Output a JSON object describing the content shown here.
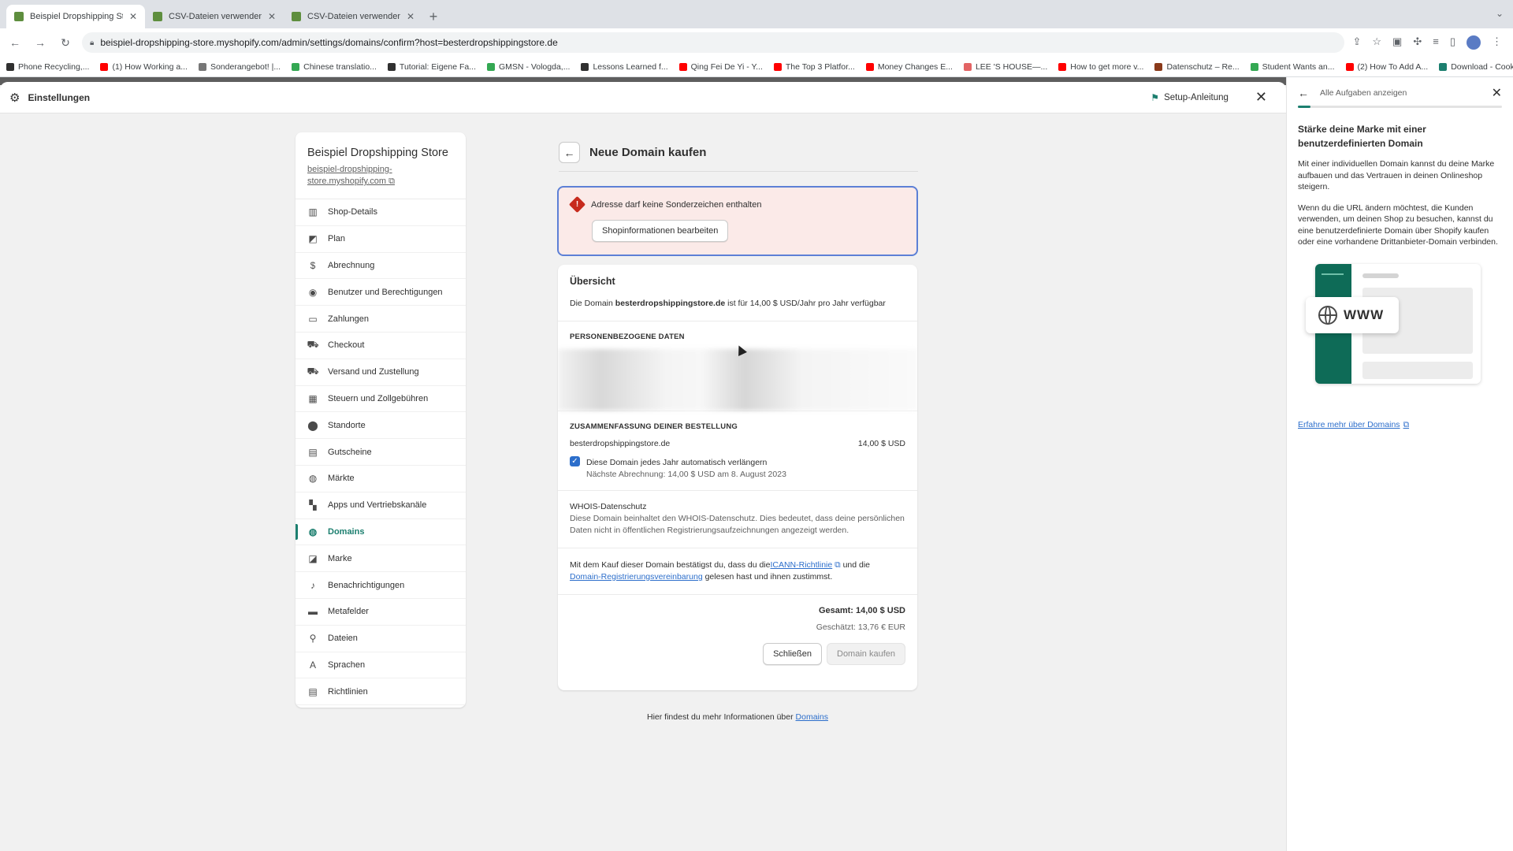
{
  "browser": {
    "tabs": [
      {
        "title": "Beispiel Dropshipping Store · S",
        "active": true
      },
      {
        "title": "CSV-Dateien verwenden, um P",
        "active": false
      },
      {
        "title": "CSV-Dateien verwenden, um P",
        "active": false
      }
    ],
    "new_tab": "+",
    "url": "beispiel-dropshipping-store.myshopify.com/admin/settings/domains/confirm?host=besterdropshippingstore.de",
    "bookmarks": [
      {
        "label": "Phone Recycling,...",
        "color": "#303030"
      },
      {
        "label": "(1) How Working a...",
        "color": "#ff0000"
      },
      {
        "label": "Sonderangebot! |...",
        "color": "#777777"
      },
      {
        "label": "Chinese translatio...",
        "color": "#34a853"
      },
      {
        "label": "Tutorial: Eigene Fa...",
        "color": "#303030"
      },
      {
        "label": "GMSN - Vologda,...",
        "color": "#34a853"
      },
      {
        "label": "Lessons Learned f...",
        "color": "#303030"
      },
      {
        "label": "Qing Fei De Yi - Y...",
        "color": "#ff0000"
      },
      {
        "label": "The Top 3 Platfor...",
        "color": "#ff0000"
      },
      {
        "label": "Money Changes E...",
        "color": "#ff0000"
      },
      {
        "label": "LEE 'S HOUSE—...",
        "color": "#e36464"
      },
      {
        "label": "How to get more v...",
        "color": "#ff0000"
      },
      {
        "label": "Datenschutz – Re...",
        "color": "#8a3a1a"
      },
      {
        "label": "Student Wants an...",
        "color": "#34a853"
      },
      {
        "label": "(2) How To Add A...",
        "color": "#ff0000"
      },
      {
        "label": "Download - Cooki...",
        "color": "#1c7f6f"
      }
    ]
  },
  "settings": {
    "title": "Einstellungen",
    "setup_label": "Setup-Anleitung"
  },
  "store": {
    "name": "Beispiel Dropshipping Store",
    "url": "beispiel-dropshipping-store.myshopify.com"
  },
  "nav": [
    {
      "label": "Shop-Details",
      "icon": "store-icon",
      "glyph": "▥"
    },
    {
      "label": "Plan",
      "icon": "plan-icon",
      "glyph": "◩"
    },
    {
      "label": "Abrechnung",
      "icon": "billing-icon",
      "glyph": "$"
    },
    {
      "label": "Benutzer und Berechtigungen",
      "icon": "user-icon",
      "glyph": "◉"
    },
    {
      "label": "Zahlungen",
      "icon": "payments-icon",
      "glyph": "▭"
    },
    {
      "label": "Checkout",
      "icon": "cart-icon",
      "glyph": "⛟"
    },
    {
      "label": "Versand und Zustellung",
      "icon": "truck-icon",
      "glyph": "⛟"
    },
    {
      "label": "Steuern und Zollgebühren",
      "icon": "tax-icon",
      "glyph": "▦"
    },
    {
      "label": "Standorte",
      "icon": "location-icon",
      "glyph": "⬤"
    },
    {
      "label": "Gutscheine",
      "icon": "gift-icon",
      "glyph": "▤"
    },
    {
      "label": "Märkte",
      "icon": "globe-icon",
      "glyph": "◍"
    },
    {
      "label": "Apps und Vertriebskanäle",
      "icon": "apps-icon",
      "glyph": "▚"
    },
    {
      "label": "Domains",
      "icon": "domains-icon",
      "glyph": "◍",
      "active": true
    },
    {
      "label": "Marke",
      "icon": "brand-icon",
      "glyph": "◪"
    },
    {
      "label": "Benachrichtigungen",
      "icon": "bell-icon",
      "glyph": "♪"
    },
    {
      "label": "Metafelder",
      "icon": "metafields-icon",
      "glyph": "▬"
    },
    {
      "label": "Dateien",
      "icon": "paperclip-icon",
      "glyph": "⚲"
    },
    {
      "label": "Sprachen",
      "icon": "language-icon",
      "glyph": "A"
    },
    {
      "label": "Richtlinien",
      "icon": "policy-icon",
      "glyph": "▤"
    }
  ],
  "page": {
    "title": "Neue Domain kaufen",
    "alert": {
      "message": "Adresse darf keine Sonderzeichen enthalten",
      "button": "Shopinformationen bearbeiten"
    },
    "overview": {
      "title": "Übersicht",
      "text_before": "Die Domain ",
      "domain": "besterdropshippingstore.de",
      "text_after": " ist für 14,00 $ USD/Jahr pro Jahr verfügbar"
    },
    "personal_data_label": "PERSONENBEZOGENE DATEN",
    "order_summary": {
      "label": "ZUSAMMENFASSUNG DEINER BESTELLUNG",
      "item": "besterdropshippingstore.de",
      "price": "14,00 $ USD",
      "auto_renew_label": "Diese Domain jedes Jahr automatisch verlängern",
      "auto_renew_checked": true,
      "next_billing": "Nächste Abrechnung: 14,00 $ USD am 8. August 2023"
    },
    "whois": {
      "title": "WHOIS-Datenschutz",
      "text": "Diese Domain beinhaltet den WHOIS-Datenschutz. Dies bedeutet, dass deine persönlichen Daten nicht in öffentlichen Registrierungsaufzeichnungen angezeigt werden."
    },
    "terms": {
      "text1": "Mit dem Kauf dieser Domain bestätigst du, dass du die",
      "link1": "ICANN-Richtlinie",
      "text2": " und die",
      "link2": "Domain-Registrierungsvereinbarung",
      "text3": " gelesen hast und ihnen zustimmst."
    },
    "total": "Gesamt: 14,00 $ USD",
    "estimate": "Geschätzt: 13,76 € EUR",
    "close_button": "Schließen",
    "buy_button": "Domain kaufen",
    "footer_text": "Hier findest du mehr Informationen über ",
    "footer_link": "Domains"
  },
  "side_panel": {
    "back_label": "Alle Aufgaben anzeigen",
    "title": "Stärke deine Marke mit einer benutzerdefinierten Domain",
    "para1": "Mit einer individuellen Domain kannst du deine Marke aufbauen und das Vertrauen in deinen Onlineshop steigern.",
    "para2": "Wenn du die URL ändern möchtest, die Kunden verwenden, um deinen Shop zu besuchen, kannst du eine benutzerdefinierte Domain über Shopify kaufen oder eine vorhandene Drittanbieter-Domain verbinden.",
    "illustration_text": "WWW",
    "learn_more": "Erfahre mehr über Domains"
  },
  "colors": {
    "accent": "#1c7f6f",
    "link": "#2c6ecb",
    "error": "#c72b1e",
    "alert_bg": "#fbeae8"
  }
}
